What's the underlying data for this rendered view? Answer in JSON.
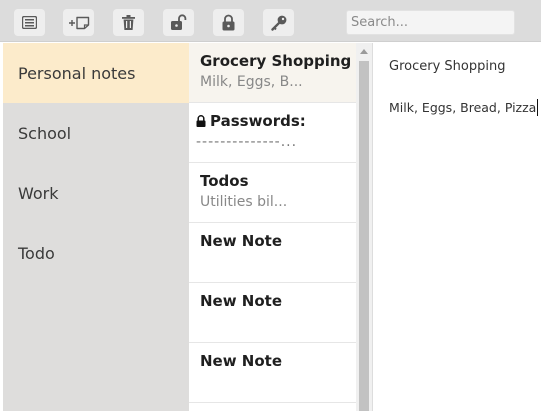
{
  "toolbar": {
    "buttons": [
      {
        "name": "list-view-icon"
      },
      {
        "name": "new-note-icon"
      },
      {
        "name": "trash-icon"
      },
      {
        "name": "unlock-icon"
      },
      {
        "name": "lock-icon"
      },
      {
        "name": "key-icon"
      }
    ],
    "search_placeholder": "Search..."
  },
  "sidebar": {
    "items": [
      {
        "label": "Personal notes",
        "active": true
      },
      {
        "label": "School"
      },
      {
        "label": "Work"
      },
      {
        "label": "Todo"
      }
    ]
  },
  "notes": [
    {
      "title": "Grocery Shopping",
      "preview": "Milk, Eggs, B...",
      "active": true
    },
    {
      "title": "Passwords:",
      "preview": "--------------...",
      "locked": true
    },
    {
      "title": "Todos",
      "preview": "Utilities bil..."
    },
    {
      "title": "New Note",
      "preview": ""
    },
    {
      "title": "New Note",
      "preview": ""
    },
    {
      "title": "New Note",
      "preview": ""
    }
  ],
  "editor": {
    "title": "Grocery Shopping",
    "body": "Milk, Eggs, Bread, Pizza"
  },
  "colors": {
    "toolbar_bg": "#dcdcdc",
    "sidebar_bg": "#dedddc",
    "active_category_bg": "#fcebcb",
    "active_note_bg": "#f7f4ee"
  }
}
